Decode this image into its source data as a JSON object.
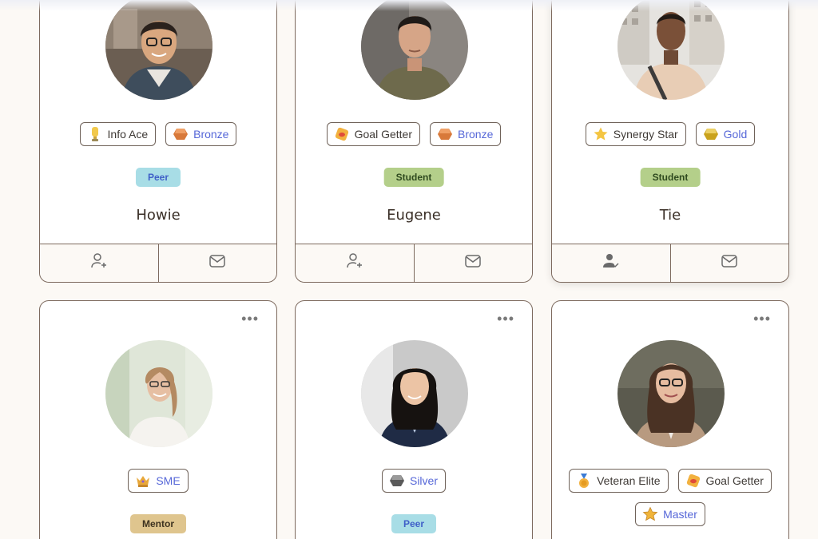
{
  "colors": {
    "page_bg": "#fcf9f5",
    "card_border": "#7d6a5e",
    "tier_text": "#5667d8",
    "peer_bg": "#a8dde6",
    "student_bg": "#b4cf8a",
    "mentor_bg": "#dfc58e"
  },
  "cards": [
    {
      "name": "Howie",
      "role": "Peer",
      "badges": [
        {
          "label": "Info Ace",
          "icon": "trophy-light-icon"
        },
        {
          "label": "Bronze",
          "icon": "bronze-medal-icon"
        }
      ],
      "actions": [
        "add-friend-icon",
        "mail-icon"
      ]
    },
    {
      "name": "Eugene",
      "role": "Student",
      "badges": [
        {
          "label": "Goal Getter",
          "icon": "goal-badge-icon"
        },
        {
          "label": "Bronze",
          "icon": "bronze-medal-icon"
        }
      ],
      "actions": [
        "add-friend-icon",
        "mail-icon"
      ]
    },
    {
      "name": "Tie",
      "role": "Student",
      "badges": [
        {
          "label": "Synergy Star",
          "icon": "star-icon"
        },
        {
          "label": "Gold",
          "icon": "gold-medal-icon"
        }
      ],
      "actions": [
        "friend-added-icon",
        "mail-icon"
      ]
    },
    {
      "role": "Mentor",
      "badges": [
        {
          "label": "SME",
          "icon": "crown-icon"
        }
      ],
      "menu": "more-options-icon"
    },
    {
      "role": "Peer",
      "badges": [
        {
          "label": "Silver",
          "icon": "silver-medal-icon"
        }
      ],
      "menu": "more-options-icon"
    },
    {
      "badges": [
        {
          "label": "Veteran Elite",
          "icon": "medal-ribbon-icon"
        },
        {
          "label": "Goal Getter",
          "icon": "goal-badge-icon"
        },
        {
          "label": "Master",
          "icon": "star-icon"
        }
      ],
      "menu": "more-options-icon"
    }
  ]
}
